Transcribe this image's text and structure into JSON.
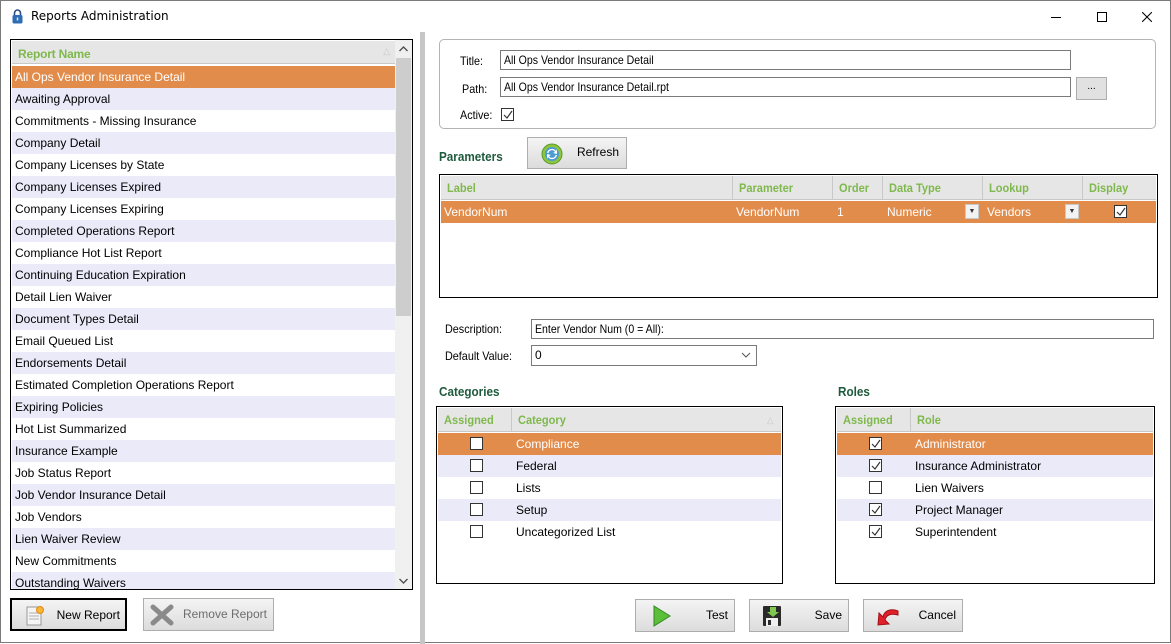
{
  "window": {
    "title": "Reports Administration",
    "icon": "padlock-icon",
    "controls": {
      "minimize": "minimize-icon",
      "maximize": "maximize-icon",
      "close": "close-icon"
    }
  },
  "report_list": {
    "header": "Report Name",
    "selected_index": 0,
    "items": [
      "All Ops Vendor Insurance Detail",
      "Awaiting Approval",
      "Commitments - Missing Insurance",
      "Company Detail",
      "Company Licenses by State",
      "Company Licenses Expired",
      "Company Licenses Expiring",
      "Completed Operations Report",
      "Compliance Hot List Report",
      "Continuing Education Expiration",
      "Detail Lien Waiver",
      "Document Types Detail",
      "Email Queued List",
      "Endorsements Detail",
      "Estimated Completion Operations Report",
      "Expiring Policies",
      "Hot List Summarized",
      "Insurance Example",
      "Job Status Report",
      "Job Vendor Insurance Detail",
      "Job Vendors",
      "Lien Waiver Review",
      "New Commitments",
      "Outstanding Waivers"
    ]
  },
  "left_buttons": {
    "new_report": "New Report",
    "remove_report": "Remove Report"
  },
  "report_detail": {
    "title_label": "Title:",
    "title_value": "All Ops Vendor Insurance Detail",
    "path_label": "Path:",
    "path_value": "All Ops Vendor Insurance Detail.rpt",
    "browse_label": "...",
    "active_label": "Active:",
    "active_checked": true
  },
  "parameters": {
    "title": "Parameters",
    "refresh_label": "Refresh",
    "columns": [
      "Label",
      "Parameter",
      "Order",
      "Data Type",
      "Lookup",
      "Display"
    ],
    "rows": [
      {
        "label": "VendorNum",
        "parameter": "VendorNum",
        "order": "1",
        "data_type": "Numeric",
        "lookup": "Vendors",
        "display": true
      }
    ],
    "description_label": "Description:",
    "description_value": "Enter Vendor Num (0 = All):",
    "default_label": "Default Value:",
    "default_value": "0"
  },
  "categories": {
    "title": "Categories",
    "columns": [
      "Assigned",
      "Category"
    ],
    "rows": [
      {
        "name": "Compliance",
        "assigned": false
      },
      {
        "name": "Federal",
        "assigned": false
      },
      {
        "name": "Lists",
        "assigned": false
      },
      {
        "name": "Setup",
        "assigned": false
      },
      {
        "name": "Uncategorized List",
        "assigned": false
      }
    ]
  },
  "roles": {
    "title": "Roles",
    "columns": [
      "Assigned",
      "Role"
    ],
    "rows": [
      {
        "name": "Administrator",
        "assigned": true
      },
      {
        "name": "Insurance Administrator",
        "assigned": true
      },
      {
        "name": "Lien Waivers",
        "assigned": false
      },
      {
        "name": "Project Manager",
        "assigned": true
      },
      {
        "name": "Superintendent",
        "assigned": true
      }
    ]
  },
  "actions": {
    "test": "Test",
    "save": "Save",
    "cancel": "Cancel"
  },
  "colors": {
    "selection": "#e28c4c",
    "alt_row": "#eaeaf9",
    "header_text": "#7fb84d",
    "section_title": "#1e5a3c"
  }
}
